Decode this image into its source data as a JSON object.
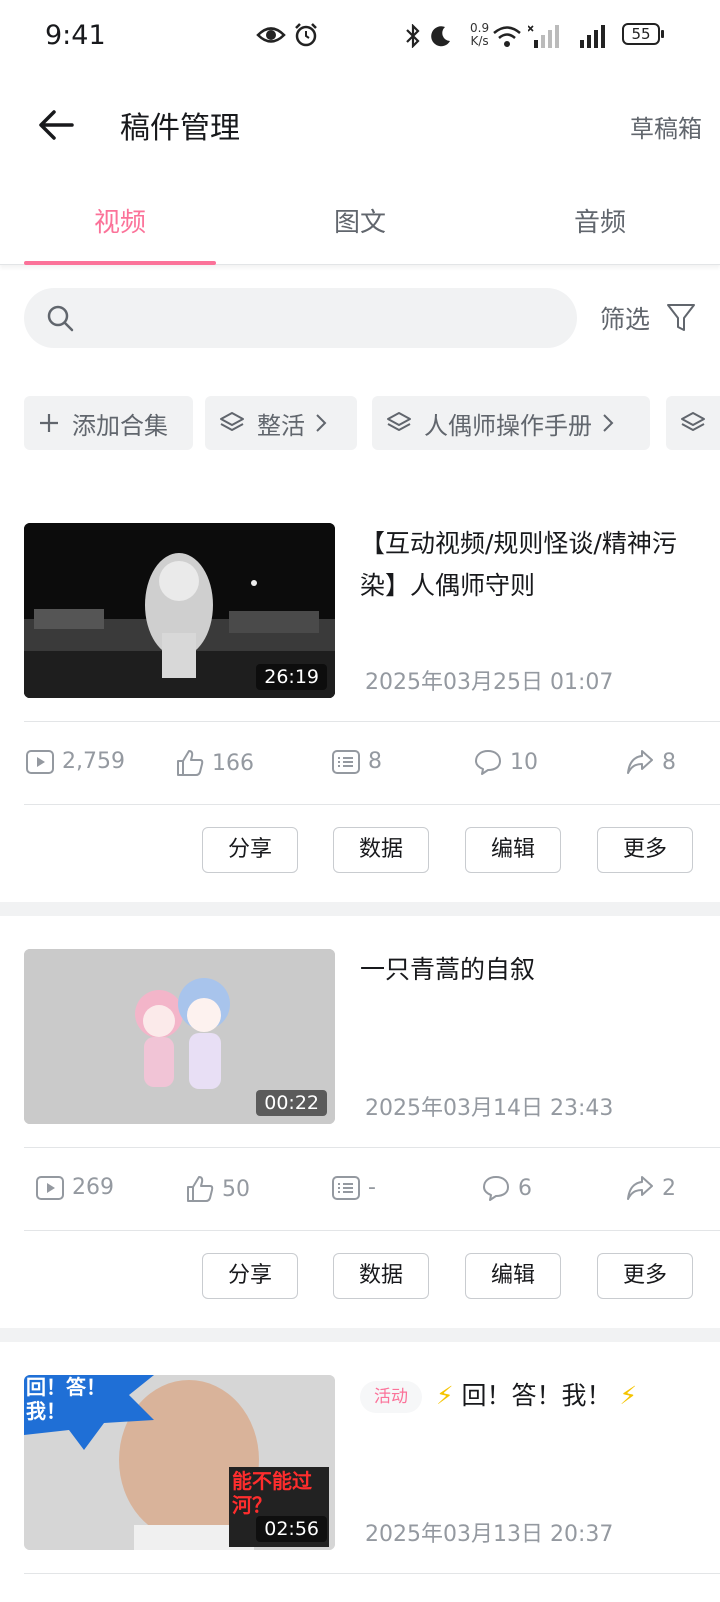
{
  "status_bar": {
    "time": "9:41",
    "net_speed_value": "0.9",
    "net_speed_unit": "K/s",
    "battery": "55"
  },
  "header": {
    "title": "稿件管理",
    "drafts": "草稿箱"
  },
  "tabs": [
    {
      "label": "视频",
      "active": true
    },
    {
      "label": "图文",
      "active": false
    },
    {
      "label": "音频",
      "active": false
    }
  ],
  "search": {
    "placeholder": ""
  },
  "filter": {
    "label": "筛选"
  },
  "collections": [
    {
      "label": "添加合集",
      "icon": "plus-icon"
    },
    {
      "label": "整活",
      "icon": "layers-icon"
    },
    {
      "label": "人偶师操作手册",
      "icon": "layers-icon"
    }
  ],
  "colors": {
    "accent": "#fb7299",
    "text_primary": "#18191c",
    "text_secondary": "#61666d",
    "text_muted": "#9499a0",
    "divider": "#e3e5e7"
  },
  "videos": [
    {
      "title": "【互动视频/规则怪谈/精神污染】人偶师守则",
      "badge": "",
      "date": "2025年03月25日 01:07",
      "duration": "26:19",
      "stats": {
        "views": "2,759",
        "likes": "166",
        "danmaku": "8",
        "comments": "10",
        "shares": "8"
      }
    },
    {
      "title": "一只青蒿的自叙",
      "badge": "",
      "date": "2025年03月14日 23:43",
      "duration": "00:22",
      "stats": {
        "views": "269",
        "likes": "50",
        "danmaku": "-",
        "comments": "6",
        "shares": "2"
      }
    },
    {
      "title": "回！答！我！",
      "badge": "活动",
      "date": "2025年03月13日 20:37",
      "duration": "02:56",
      "thumb_text_top": "回！答！我！",
      "thumb_text_bottom": "能不能过河？"
    }
  ],
  "actions": {
    "share": "分享",
    "data": "数据",
    "edit": "编辑",
    "more": "更多"
  }
}
